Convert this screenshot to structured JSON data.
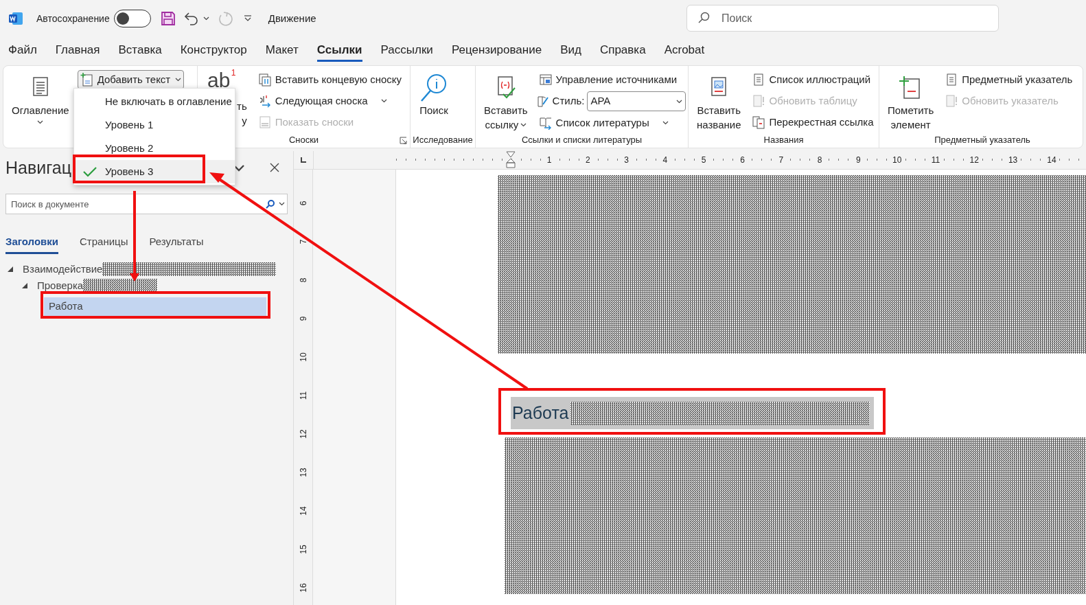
{
  "title_bar": {
    "autosave_label": "Автосохранение",
    "autosave_on": false,
    "document_title": "Движение",
    "search_placeholder": "Поиск"
  },
  "tabs": [
    {
      "label": "Файл",
      "selected": false
    },
    {
      "label": "Главная",
      "selected": false
    },
    {
      "label": "Вставка",
      "selected": false
    },
    {
      "label": "Конструктор",
      "selected": false
    },
    {
      "label": "Макет",
      "selected": false
    },
    {
      "label": "Ссылки",
      "selected": true
    },
    {
      "label": "Рассылки",
      "selected": false
    },
    {
      "label": "Рецензирование",
      "selected": false
    },
    {
      "label": "Вид",
      "selected": false
    },
    {
      "label": "Справка",
      "selected": false
    },
    {
      "label": "Acrobat",
      "selected": false
    }
  ],
  "ribbon": {
    "groups": [
      {
        "items": [
          {
            "kind": "large",
            "lines": [
              "Оглавление"
            ],
            "dropdown": true
          },
          {
            "kind": "column",
            "items": [
              {
                "label": "Добавить текст",
                "dropdown": true,
                "disabled": false,
                "pressed": true
              }
            ]
          }
        ]
      },
      {
        "label": "Сноски",
        "launcher": true,
        "items": [
          {
            "kind": "large",
            "glyph": "ab",
            "glyph_mark": "1",
            "lines": [
              "ть",
              "у"
            ],
            "dropdown": false
          },
          {
            "kind": "column",
            "items": [
              {
                "label": "Вставить концевую сноску",
                "dropdown": false,
                "disabled": false,
                "pressed": false
              },
              {
                "label": "Следующая сноска",
                "dropdown": true,
                "disabled": false,
                "pressed": false
              },
              {
                "label": "Показать сноски",
                "dropdown": false,
                "disabled": true,
                "pressed": false
              }
            ]
          }
        ]
      },
      {
        "label": "Исследование",
        "launcher": false,
        "items": [
          {
            "kind": "large",
            "lines": [
              "Поиск"
            ],
            "dropdown": false
          }
        ]
      },
      {
        "label": "Ссылки и списки литературы",
        "launcher": false,
        "items": [
          {
            "kind": "large",
            "lines": [
              "Вставить",
              "ссылку"
            ],
            "dropdown": true
          },
          {
            "kind": "column",
            "items": [
              {
                "label": "Управление источниками",
                "dropdown": false,
                "disabled": false,
                "pressed": false
              },
              {
                "kind": "combo",
                "label": "Стиль:",
                "value": "APA"
              },
              {
                "label": "Список литературы",
                "dropdown": true,
                "disabled": false,
                "pressed": false
              }
            ]
          }
        ]
      },
      {
        "label": "Названия",
        "launcher": false,
        "items": [
          {
            "kind": "large",
            "lines": [
              "Вставить",
              "название"
            ],
            "dropdown": false
          },
          {
            "kind": "column",
            "items": [
              {
                "label": "Список иллюстраций",
                "dropdown": false,
                "disabled": false,
                "pressed": false
              },
              {
                "label": "Обновить таблицу",
                "dropdown": false,
                "disabled": true,
                "pressed": false
              },
              {
                "label": "Перекрестная ссылка",
                "dropdown": false,
                "disabled": false,
                "pressed": false
              }
            ]
          }
        ]
      },
      {
        "label": "Предметный указатель",
        "launcher": false,
        "items": [
          {
            "kind": "large",
            "lines": [
              "Пометить",
              "элемент"
            ],
            "dropdown": false
          },
          {
            "kind": "column",
            "items": [
              {
                "label": "Предметный указатель",
                "dropdown": false,
                "disabled": false,
                "pressed": false
              },
              {
                "label": "Обновить указатель",
                "dropdown": false,
                "disabled": true,
                "pressed": false
              }
            ]
          }
        ]
      }
    ]
  },
  "dropdown_menu": {
    "items": [
      {
        "label": "Не включать в оглавление",
        "checked": false,
        "selected": false
      },
      {
        "label": "Уровень 1",
        "checked": false,
        "selected": false
      },
      {
        "label": "Уровень 2",
        "checked": false,
        "selected": false
      },
      {
        "label": "Уровень 3",
        "checked": true,
        "selected": true
      }
    ]
  },
  "navigation": {
    "title": "Навигац",
    "search_placeholder": "Поиск в документе",
    "tabs": [
      {
        "label": "Заголовки",
        "selected": true
      },
      {
        "label": "Страницы",
        "selected": false
      },
      {
        "label": "Результаты",
        "selected": false
      }
    ],
    "tree": [
      {
        "label": "Взаимодействие",
        "redacted": true,
        "expanded": true,
        "selected": false,
        "children": [
          {
            "label": "Проверка",
            "redacted": true,
            "expanded": true,
            "selected": false,
            "children": [
              {
                "label": "Работа",
                "redacted": false,
                "selected": true
              }
            ]
          }
        ]
      }
    ]
  },
  "rulers": {
    "horizontal": [
      "1",
      "2",
      "3",
      "4",
      "5",
      "6",
      "7",
      "8",
      "9",
      "10",
      "11",
      "12",
      "13",
      "14"
    ],
    "vertical": [
      "6",
      "7",
      "8",
      "9",
      "10",
      "11",
      "12",
      "13",
      "14",
      "15",
      "16"
    ]
  },
  "document": {
    "heading": {
      "text": "Работа",
      "redacted": true,
      "highlighted": true
    }
  }
}
